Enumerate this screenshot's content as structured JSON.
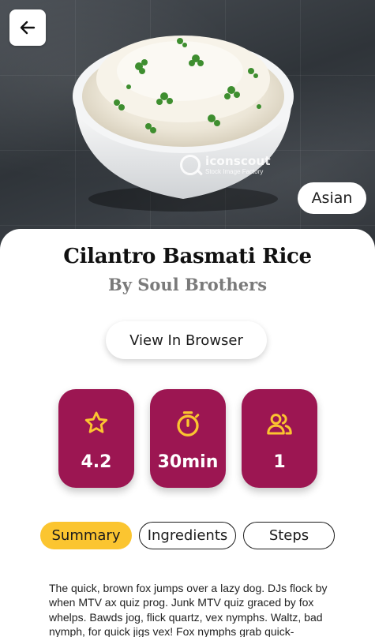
{
  "colors": {
    "accent": "#9c1652",
    "tab_active": "#fbc530",
    "stat_icon": "#fbc530"
  },
  "hero": {
    "watermark_brand": "iconscout",
    "watermark_sub": "Stock Image Factory",
    "cuisine": "Asian"
  },
  "recipe": {
    "title": "Cilantro Basmati Rice",
    "author": "By Soul Brothers",
    "view_button": "View In Browser"
  },
  "stats": [
    {
      "icon": "star-icon",
      "value": "4.2"
    },
    {
      "icon": "timer-icon",
      "value": "30min"
    },
    {
      "icon": "people-icon",
      "value": "1"
    }
  ],
  "tabs": [
    {
      "label": "Summary",
      "active": true
    },
    {
      "label": "Ingredients",
      "active": false
    },
    {
      "label": "Steps",
      "active": false
    }
  ],
  "summary": "The quick, brown fox jumps over a lazy dog. DJs flock by when MTV ax quiz prog. Junk MTV quiz graced by fox whelps. Bawds jog, flick quartz, vex nymphs. Waltz, bad nymph, for quick jigs vex! Fox nymphs grab quick-"
}
